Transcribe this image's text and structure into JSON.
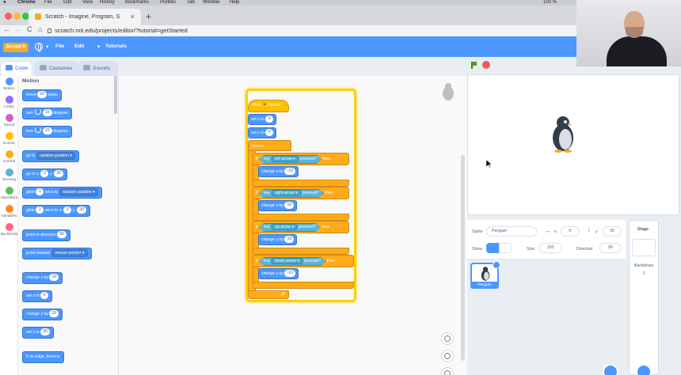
{
  "macbar": {
    "app": "Chrome",
    "menus": [
      "File",
      "Edit",
      "View",
      "History",
      "Bookmarks",
      "Profiles",
      "Tab",
      "Window",
      "Help"
    ],
    "battery": "100 %"
  },
  "browser": {
    "tab_title": "Scratch - Imagine, Program, S",
    "tab_close": "×",
    "new_tab": "+",
    "url": "scratch.mit.edu/projects/editor/?tutorial=getStarted",
    "back": "←",
    "forward": "→",
    "reload": "C"
  },
  "scratch_menu": {
    "logo": "Scratch",
    "file": "File",
    "edit": "Edit",
    "tutorials": "Tutorials"
  },
  "editor_tabs": {
    "code": "Code",
    "costumes": "Costumes",
    "sounds": "Sounds"
  },
  "categories": [
    {
      "label": "Motion",
      "color": "#4c97ff"
    },
    {
      "label": "Looks",
      "color": "#9966ff"
    },
    {
      "label": "Sound",
      "color": "#cf63cf"
    },
    {
      "label": "Events",
      "color": "#ffbf00"
    },
    {
      "label": "Control",
      "color": "#ffab19"
    },
    {
      "label": "Sensing",
      "color": "#5cb1d6"
    },
    {
      "label": "Operators",
      "color": "#59c059"
    },
    {
      "label": "Variables",
      "color": "#ff8c1a"
    },
    {
      "label": "My Blocks",
      "color": "#ff6680"
    }
  ],
  "palette": {
    "title": "Motion",
    "move": {
      "pre": "move",
      "val": "10",
      "post": "steps"
    },
    "turn_right": {
      "pre": "turn",
      "val": "15",
      "post": "degrees"
    },
    "turn_left": {
      "pre": "turn",
      "val": "15",
      "post": "degrees"
    },
    "go_to": {
      "pre": "go to",
      "dd": "random position ▾"
    },
    "go_to_xy": {
      "pre": "go to x:",
      "x": "0",
      "mid": "y:",
      "y": "30"
    },
    "glide_to": {
      "pre": "glide",
      "val": "1",
      "mid": "secs to",
      "dd": "random position ▾"
    },
    "glide_xy": {
      "pre": "glide",
      "val": "1",
      "mid": "secs to x:",
      "x": "0",
      "mid2": "y:",
      "y": "30"
    },
    "point_dir": {
      "pre": "point in direction",
      "val": "90"
    },
    "point_towards": {
      "pre": "point towards",
      "dd": "mouse-pointer ▾"
    },
    "change_x": {
      "pre": "change x by",
      "val": "10"
    },
    "set_x": {
      "pre": "set x to",
      "val": "0"
    },
    "change_y": {
      "pre": "change y by",
      "val": "10"
    },
    "set_y": {
      "pre": "set y to",
      "val": "30"
    },
    "bounce": {
      "pre": "if on edge, bounce"
    }
  },
  "script": {
    "hat": "when",
    "hat_post": "clicked",
    "set_x": {
      "pre": "set x to",
      "val": "0"
    },
    "set_y": {
      "pre": "set y to",
      "val": "0"
    },
    "forever": "forever",
    "ifs": [
      {
        "if": "if",
        "key": "key",
        "dd": "left arrow ▾",
        "pressed": "pressed?",
        "then": "then",
        "action": "change x by",
        "val": "-10"
      },
      {
        "if": "if",
        "key": "key",
        "dd": "right arrow ▾",
        "pressed": "pressed?",
        "then": "then",
        "action": "change x by",
        "val": "10"
      },
      {
        "if": "if",
        "key": "key",
        "dd": "up arrow ▾",
        "pressed": "pressed?",
        "then": "then",
        "action": "change y by",
        "val": "10"
      },
      {
        "if": "if",
        "key": "key",
        "dd": "down arrow ▾",
        "pressed": "pressed?",
        "then": "then",
        "action": "change y by",
        "val": "-10"
      }
    ],
    "loop_arrow": "↺"
  },
  "sprite_info": {
    "sprite_label": "Sprite",
    "sprite_name": "Penguin",
    "x_label": "x",
    "x": "0",
    "y_label": "y",
    "y": "30",
    "show_label": "Show",
    "size_label": "Size",
    "size": "100",
    "direction_label": "Direction",
    "direction": "90"
  },
  "sprite_card_name": "Penguin",
  "stage_panel": {
    "title": "Stage",
    "backdrops_label": "Backdrops",
    "backdrops_count": "1"
  }
}
